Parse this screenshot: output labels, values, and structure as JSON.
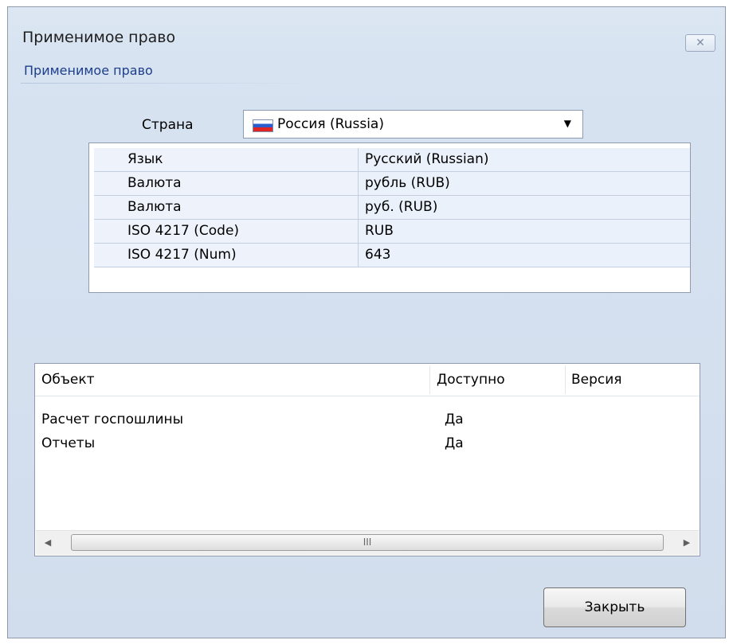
{
  "window": {
    "title": "Применимое право",
    "close_glyph": "✕"
  },
  "group": {
    "title": "Применимое право"
  },
  "country": {
    "label": "Страна",
    "selected": "Россия (Russia)",
    "flag_icon": "russia-flag-icon",
    "dropdown_glyph": "▼"
  },
  "info": {
    "rows": [
      {
        "key": "Язык",
        "value": "Русский (Russian)"
      },
      {
        "key": "Валюта",
        "value": "рубль (RUB)"
      },
      {
        "key": "Валюта",
        "value": "руб. (RUB)"
      },
      {
        "key": "ISO 4217 (Code)",
        "value": "RUB"
      },
      {
        "key": "ISO 4217 (Num)",
        "value": "643"
      }
    ]
  },
  "objects": {
    "columns": [
      "Объект",
      "Доступно",
      "Версия"
    ],
    "rows": [
      {
        "object": "Расчет госпошлины",
        "available": "Да",
        "version": ""
      },
      {
        "object": "Отчеты",
        "available": "Да",
        "version": ""
      }
    ],
    "scroll_left_glyph": "◀",
    "scroll_right_glyph": "▶",
    "scroll_grip": "III"
  },
  "footer": {
    "close_label": "Закрыть"
  },
  "colors": {
    "title_blue": "#1d3e8a",
    "window_bg": "#d7e3f1"
  }
}
